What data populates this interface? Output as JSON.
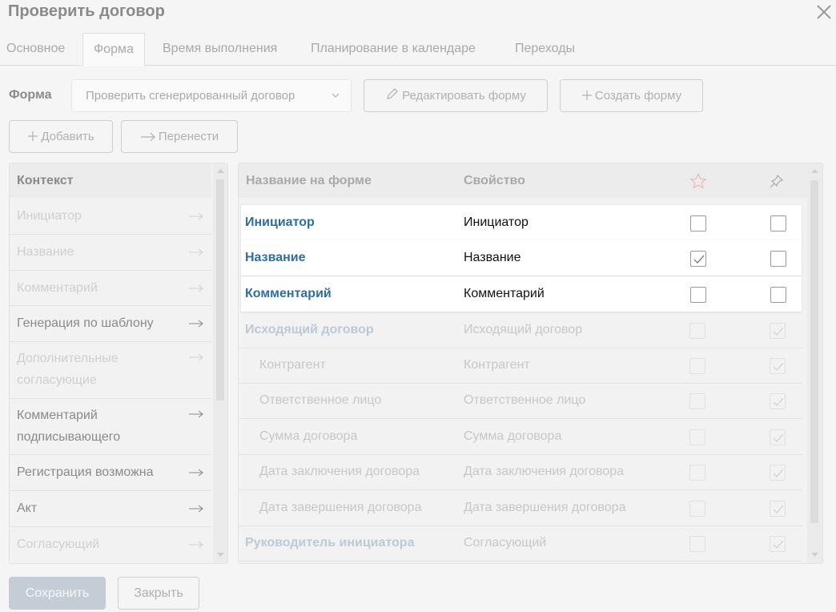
{
  "dialog": {
    "title": "Проверить договор"
  },
  "tabs": [
    {
      "label": "Основное"
    },
    {
      "label": "Форма"
    },
    {
      "label": "Время выполнения"
    },
    {
      "label": "Планирование в календаре"
    },
    {
      "label": "Переходы"
    }
  ],
  "form": {
    "label": "Форма",
    "selected": "Проверить сгенерированный договор",
    "edit_label": "Редактировать форму",
    "create_label": "Создать форму"
  },
  "toolbar": {
    "add_label": "Добавить",
    "move_label": "Перенести"
  },
  "context": {
    "header": "Контекст",
    "items": [
      {
        "line1": "Инициатор",
        "line2": ""
      },
      {
        "line1": "Название",
        "line2": ""
      },
      {
        "line1": "Комментарий",
        "line2": ""
      },
      {
        "line1": "Генерация по шаблону",
        "line2": ""
      },
      {
        "line1": "Дополнительные",
        "line2": "согласующие"
      },
      {
        "line1": "Комментарий",
        "line2": "подписывающего"
      },
      {
        "line1": "Регистрация возможна",
        "line2": ""
      },
      {
        "line1": "Акт",
        "line2": ""
      },
      {
        "line1": "Согласующий",
        "line2": ""
      }
    ]
  },
  "table": {
    "col_name": "Название на форме",
    "col_property": "Свойство",
    "rows": [
      {
        "name": "Инициатор",
        "property": "Инициатор",
        "star": false,
        "pin": false
      },
      {
        "name": "Название",
        "property": "Название",
        "star": true,
        "pin": false
      },
      {
        "name": "Комментарий",
        "property": "Комментарий",
        "star": false,
        "pin": false
      },
      {
        "name": "Исходящий договор",
        "property": "Исходящий договор",
        "star": false,
        "pin": true
      },
      {
        "name": "Контрагент",
        "property": "Контрагент",
        "star": false,
        "pin": true
      },
      {
        "name": "Ответственное лицо",
        "property": "Ответственное лицо",
        "star": false,
        "pin": true
      },
      {
        "name": "Сумма договора",
        "property": "Сумма договора",
        "star": false,
        "pin": true
      },
      {
        "name": "Дата заключения договора",
        "property": "Дата заключения договора",
        "star": false,
        "pin": true
      },
      {
        "name": "Дата завершения договора",
        "property": "Дата завершения договора",
        "star": false,
        "pin": true
      },
      {
        "name": "Руководитель инициатора",
        "property": "Согласующий",
        "star": false,
        "pin": true
      }
    ]
  },
  "footer": {
    "save_label": "Сохранить",
    "close_label": "Закрыть"
  },
  "colors": {
    "link": "#2d6e9e",
    "star": "#f2b6b6"
  }
}
